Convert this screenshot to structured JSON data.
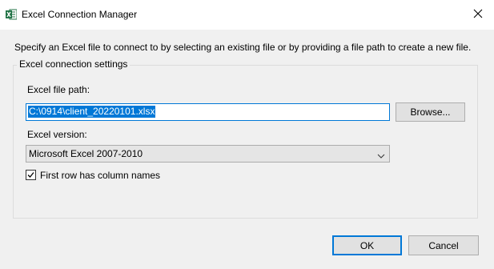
{
  "window": {
    "title": "Excel Connection Manager",
    "icon": "excel-icon",
    "close_icon": "close-icon"
  },
  "description": "Specify an Excel file to connect to by selecting an existing file or by providing a file path to create a new file.",
  "settings_group": {
    "legend": "Excel connection settings",
    "file_path_label": "Excel file path:",
    "file_path_value": "C:\\0914\\client_20220101.xlsx",
    "browse_label": "Browse...",
    "version_label": "Excel version:",
    "version_value": "Microsoft Excel 2007-2010",
    "first_row_label": "First row has column names",
    "first_row_checked": true
  },
  "buttons": {
    "ok_label": "OK",
    "cancel_label": "Cancel"
  },
  "colors": {
    "accent": "#0078d7",
    "excel_green": "#217346"
  }
}
